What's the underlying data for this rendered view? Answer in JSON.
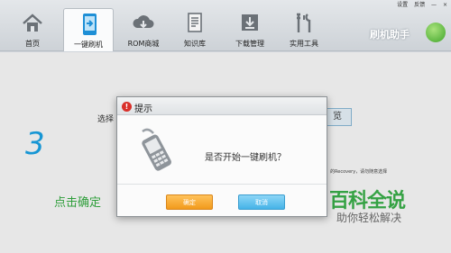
{
  "window": {
    "settings_label": "设置",
    "feedback_label": "反馈",
    "minimize_label": "—",
    "close_label": "×"
  },
  "toolbar": {
    "tabs": [
      {
        "label": "首页",
        "icon": "home-icon"
      },
      {
        "label": "一键刷机",
        "icon": "flash-phone-icon",
        "active": true
      },
      {
        "label": "ROM商城",
        "icon": "cloud-download-icon"
      },
      {
        "label": "知识库",
        "icon": "document-icon"
      },
      {
        "label": "下载管理",
        "icon": "download-icon"
      },
      {
        "label": "实用工具",
        "icon": "tools-icon"
      }
    ],
    "brand": "刷机助手"
  },
  "main": {
    "step_number": "3",
    "step_tip": "点击确定",
    "select_text": "选择",
    "bg_button_label": "览",
    "recovery_text": "的Recovery，请勿随意选择"
  },
  "watermark": {
    "title": "百科全说",
    "subtitle": "助你轻松解决"
  },
  "dialog": {
    "title": "提示",
    "message": "是否开始一键刷机？",
    "ok_label": "确定",
    "cancel_label": "取消"
  },
  "colors": {
    "accent_blue": "#1aa3e6",
    "tip_green": "#2e9e3a",
    "ok_orange": "#f29a1c",
    "cancel_blue": "#45b3e8"
  }
}
